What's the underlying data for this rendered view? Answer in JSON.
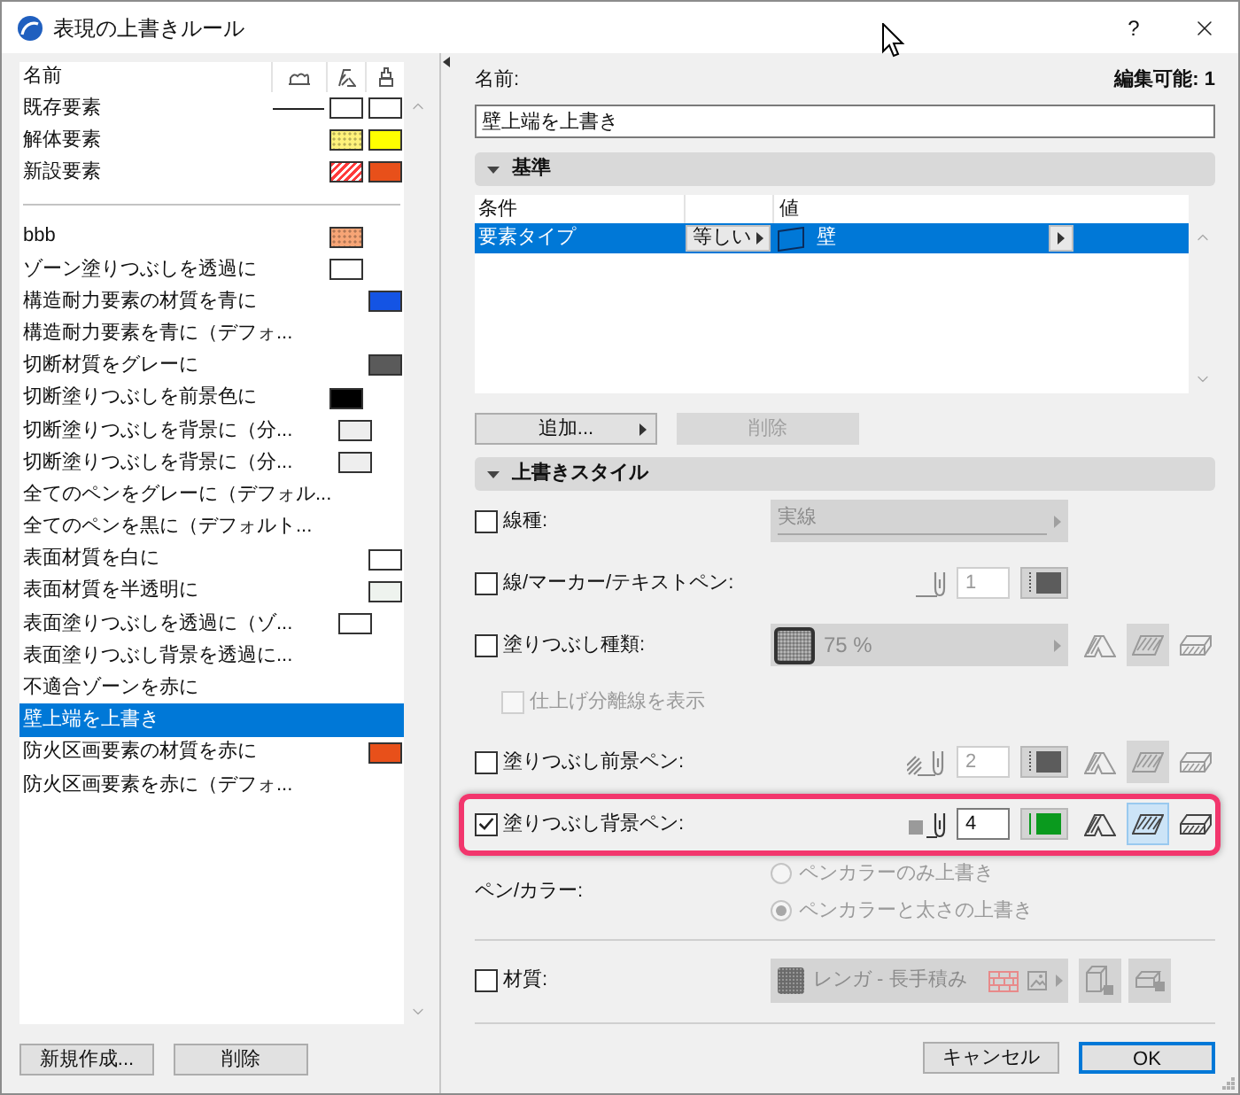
{
  "window": {
    "title": "表現の上書きルール",
    "help": "?"
  },
  "rules_list": {
    "header": "名前",
    "groups": [
      {
        "items": [
          {
            "name": "既存要素",
            "selected": false,
            "column_1": {
              "kind": "line"
            },
            "column_2": {
              "kind": "solid",
              "color": "#ffffff"
            },
            "column_3": {
              "kind": "solid",
              "color": "#ffffff"
            }
          },
          {
            "name": "解体要素",
            "selected": false,
            "column_2": {
              "kind": "dotted",
              "color": "#fff27a"
            },
            "column_3": {
              "kind": "solid",
              "color": "#ffff00"
            }
          },
          {
            "name": "新設要素",
            "selected": false,
            "column_2": {
              "kind": "hatched",
              "color": "#ff3b3b"
            },
            "column_3": {
              "kind": "solid",
              "color": "#e8501a"
            }
          }
        ]
      },
      {
        "items": [
          {
            "name": "bbb",
            "selected": false,
            "column_2": {
              "kind": "dotted",
              "color": "#f7a576"
            }
          },
          {
            "name": "ゾーン塗りつぶしを透過に",
            "selected": false,
            "column_2": {
              "kind": "solid",
              "color": "#ffffff"
            }
          },
          {
            "name": "構造耐力要素の材質を青に",
            "selected": false,
            "column_3": {
              "kind": "solid",
              "color": "#1454e4"
            }
          },
          {
            "name": "構造耐力要素を青に（デフォ...",
            "selected": false
          },
          {
            "name": "切断材質をグレーに",
            "selected": false,
            "column_3": {
              "kind": "solid",
              "color": "#5a5a5a"
            }
          },
          {
            "name": "切断塗りつぶしを前景色に",
            "selected": false,
            "column_2": {
              "kind": "solid",
              "color": "#000000"
            }
          },
          {
            "name": "切断塗りつぶしを背景に（分...",
            "selected": false,
            "column_2": {
              "kind": "solid",
              "color": "#eeeeee"
            }
          },
          {
            "name": "切断塗りつぶしを背景に（分...",
            "selected": false,
            "column_2": {
              "kind": "solid",
              "color": "#eeeeee"
            }
          },
          {
            "name": "全てのペンをグレーに（デフォル...",
            "selected": false
          },
          {
            "name": "全てのペンを黒に（デフォルト...",
            "selected": false
          },
          {
            "name": "表面材質を白に",
            "selected": false,
            "column_3": {
              "kind": "solid",
              "color": "#ffffff"
            }
          },
          {
            "name": "表面材質を半透明に",
            "selected": false,
            "column_3": {
              "kind": "solid",
              "color": "#eef3ee"
            }
          },
          {
            "name": "表面塗りつぶしを透過に（ゾ...",
            "selected": false,
            "column_2": {
              "kind": "solid",
              "color": "#ffffff"
            }
          },
          {
            "name": "表面塗りつぶし背景を透過に...",
            "selected": false
          },
          {
            "name": "不適合ゾーンを赤に",
            "selected": false
          },
          {
            "name": "壁上端を上書き",
            "selected": true
          },
          {
            "name": "防火区画要素の材質を赤に",
            "selected": false,
            "column_3": {
              "kind": "solid",
              "color": "#e8501a"
            }
          },
          {
            "name": "防火区画要素を赤に（デフォ...",
            "selected": false
          }
        ]
      }
    ],
    "buttons": [
      "新規作成...",
      "削除"
    ]
  },
  "detail": {
    "name_label": "名前:",
    "editable": "編集可能: 1",
    "name_value": "壁上端を上書き",
    "criteria": {
      "title": "基準",
      "expanded": true,
      "columns": [
        "条件",
        "値"
      ],
      "rows": [
        {
          "condition": "要素タイプ",
          "operator": "等しい",
          "value": "壁",
          "selected": true
        }
      ],
      "buttons": [
        {
          "label": "追加...",
          "disabled": false
        },
        {
          "label": "削除",
          "disabled": true
        }
      ]
    },
    "style": {
      "title": "上書きスタイル",
      "expanded": true,
      "rows": [
        {
          "kind": "dropdown",
          "label": "線種:",
          "checked": false,
          "value": "実線"
        },
        {
          "kind": "pen_line",
          "label": "線/マーカー/テキストペン:",
          "checked": false,
          "highlighted": false,
          "pen": "1",
          "color": "#5c5c5c"
        },
        {
          "kind": "fill",
          "label": "塗りつぶし種類:",
          "checked": false,
          "value": "75 %",
          "modes": [
            {
              "selected": false
            },
            {
              "selected": true
            },
            {
              "selected": false
            }
          ]
        },
        {
          "kind": "sub_option",
          "label": "仕上げ分離線を表示",
          "checked": false,
          "disabled": true
        },
        {
          "kind": "pen_hatch",
          "label": "塗りつぶし前景ペン:",
          "checked": false,
          "highlighted": false,
          "pen": "2",
          "color": "#5c5c5c",
          "modes": [
            {
              "selected": false
            },
            {
              "selected": true
            },
            {
              "selected": false
            }
          ]
        },
        {
          "kind": "pen_square",
          "label": "塗りつぶし背景ペン:",
          "checked": true,
          "highlighted": true,
          "pen": "4",
          "color": "#0a9a1e",
          "modes": [
            {
              "selected": false
            },
            {
              "selected": true
            },
            {
              "selected": false
            }
          ]
        },
        {
          "kind": "radio_group",
          "label": "ペン/カラー:",
          "disabled": true,
          "options": [
            {
              "label": "ペンカラーのみ上書き",
              "selected": false
            },
            {
              "label": "ペンカラーと太さの上書き",
              "selected": true
            }
          ]
        },
        {
          "kind": "material",
          "label": "材質:",
          "checked": false,
          "value": "レンガ - 長手積み"
        }
      ]
    },
    "buttons": [
      {
        "label": "キャンセル",
        "default": false
      },
      {
        "label": "OK",
        "default": true
      }
    ]
  }
}
